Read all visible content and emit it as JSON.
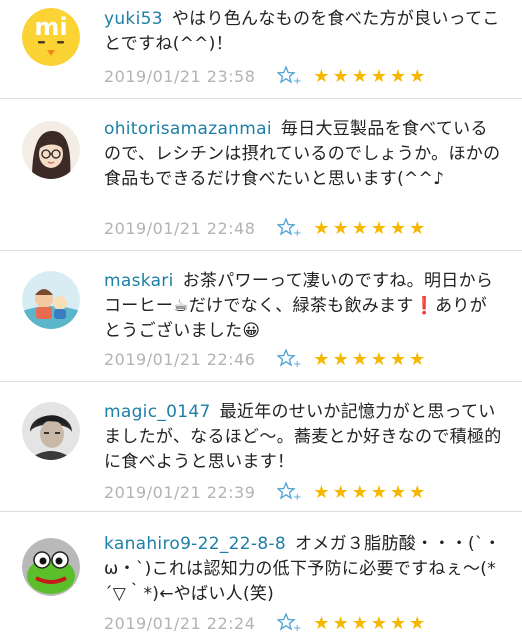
{
  "comments": [
    {
      "username": "yuki53",
      "text": "やはり色んなものを食べた方が良いってことですね(^^)！",
      "timestamp": "2019/01/21 23:58",
      "stars": 6,
      "avatar_icon": "mi-bird-avatar-icon"
    },
    {
      "username": "ohitorisamazanmai",
      "text": "毎日大豆製品を食べているので、レシチンは摂れているのでしょうか。ほかの食品もできるだけ食べたいと思います(^^♪",
      "timestamp": "2019/01/21 22:48",
      "stars": 6,
      "avatar_icon": "woman-glasses-avatar-icon"
    },
    {
      "username": "maskari",
      "text": "お茶パワーって凄いのですね。明日からコーヒー☕だけでなく、緑茶も飲みます❗ありがとうございました😀",
      "timestamp": "2019/01/21 22:46",
      "stars": 6,
      "avatar_icon": "cartoon-avatar-icon"
    },
    {
      "username": "magic_0147",
      "text": "最近年のせいか記憶力がと思っていましたが、なるほど～。蕎麦とか好きなので積極的に食べようと思います！",
      "timestamp": "2019/01/21 22:39",
      "stars": 6,
      "avatar_icon": "photo-person-avatar-icon"
    },
    {
      "username": "kanahiro9-22_22-8-8",
      "text": "オメガ３脂肪酸・・・(`・ω・`)これは認知力の低下予防に必要ですねぇ～(*´▽｀*)←やばい人(笑)",
      "timestamp": "2019/01/21 22:24",
      "stars": 6,
      "avatar_icon": "green-character-avatar-icon"
    }
  ],
  "colors": {
    "username": "#1d7fa5",
    "timestamp": "#b3b3b3",
    "star": "#f5b800",
    "divider": "#dddddd"
  },
  "star_glyph": "★"
}
